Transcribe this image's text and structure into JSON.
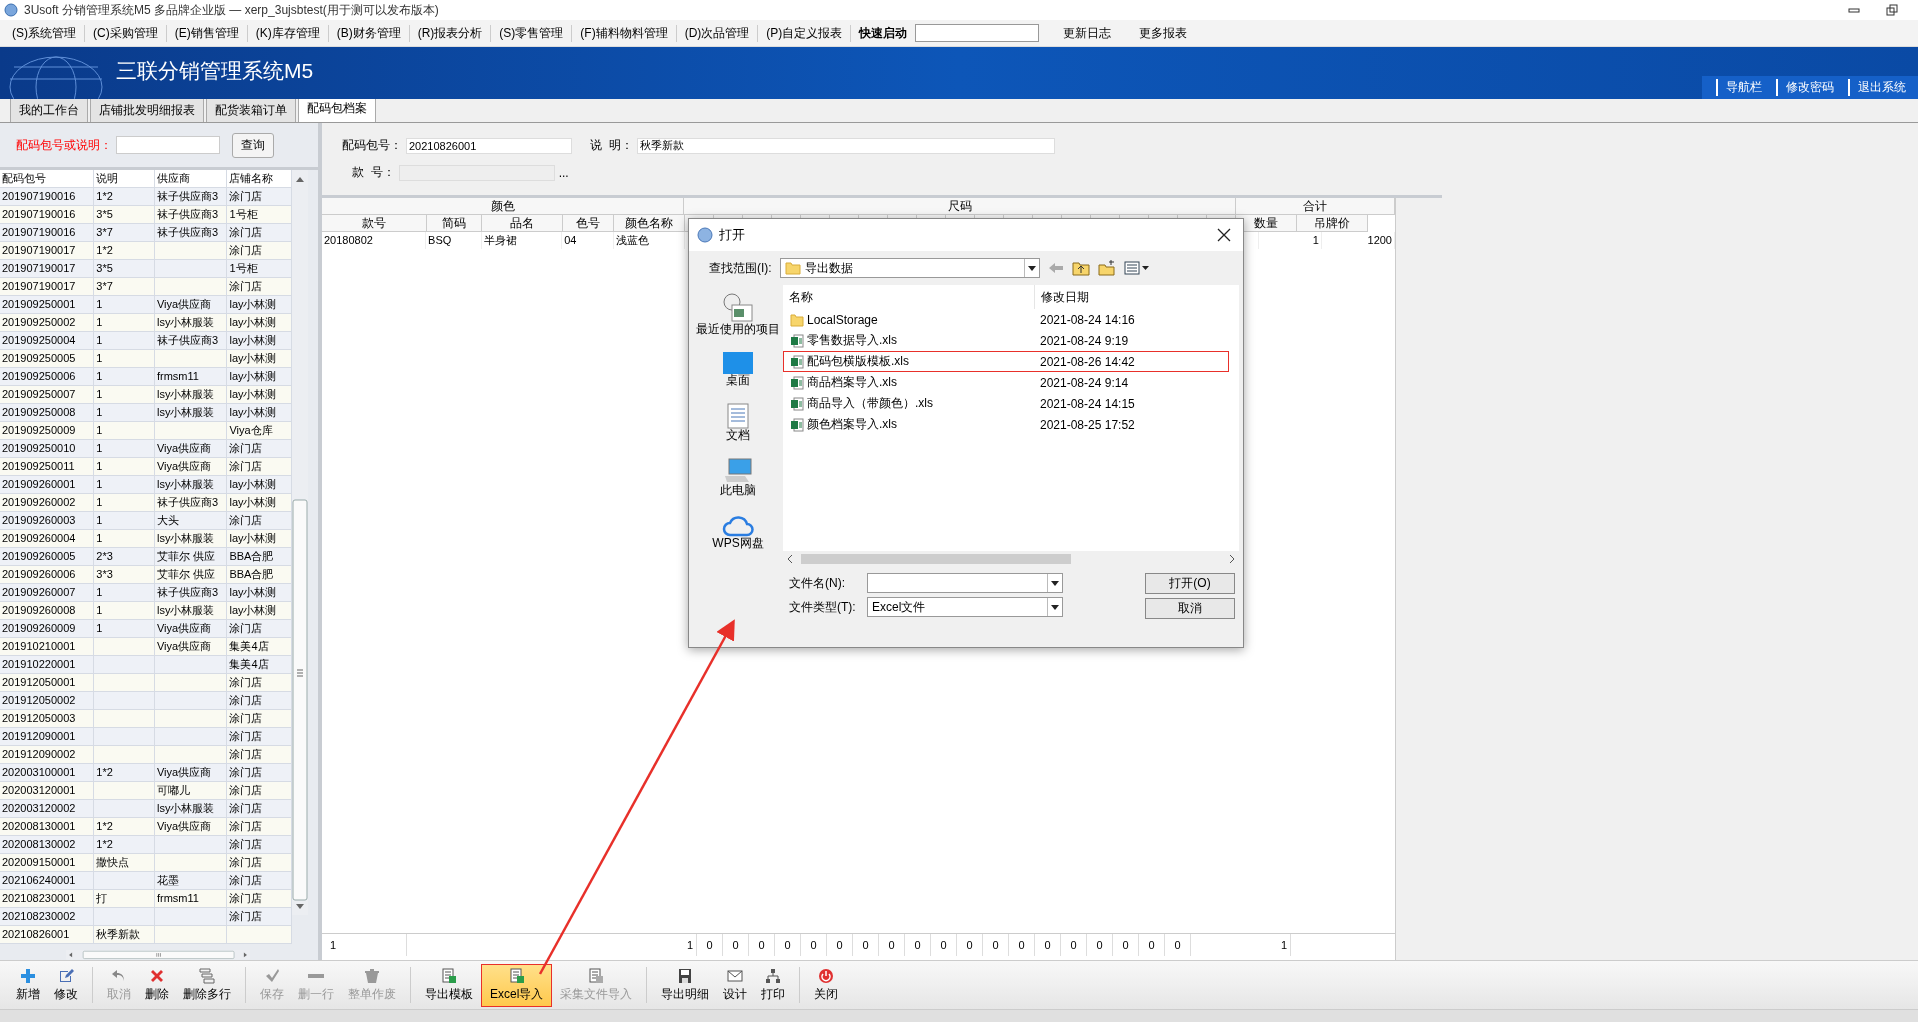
{
  "window": {
    "title": "3Usoft 分销管理系统M5 多品牌企业版 — xerp_3ujsbtest(用于测可以发布版本)"
  },
  "menu": [
    "(S)系统管理",
    "(C)采购管理",
    "(E)销售管理",
    "(K)库存管理",
    "(B)财务管理",
    "(R)报表分析",
    "(S)零售管理",
    "(F)辅料物料管理",
    "(D)次品管理",
    "(P)自定义报表"
  ],
  "quick_launch": {
    "label": "快速启动"
  },
  "menu_links": [
    "更新日志",
    "更多报表"
  ],
  "banner": {
    "title": "三联分销管理系统M5",
    "links": [
      "导航栏",
      "修改密码",
      "退出系统"
    ]
  },
  "tabs": [
    {
      "label": "我的工作台",
      "selected": false
    },
    {
      "label": "店铺批发明细报表",
      "selected": false
    },
    {
      "label": "配货装箱订单",
      "selected": false
    },
    {
      "label": "配码包档案",
      "selected": true
    }
  ],
  "search": {
    "label": "配码包号或说明：",
    "button": "查询"
  },
  "list": {
    "columns": [
      "配码包号",
      "说明",
      "供应商",
      "店铺名称"
    ],
    "rows": [
      {
        "no": "201907190016",
        "desc": "1*2",
        "supplier": "袜子供应商3",
        "store": "涂门店"
      },
      {
        "no": "201907190016",
        "desc": "3*5",
        "supplier": "袜子供应商3",
        "store": "1号柜"
      },
      {
        "no": "201907190016",
        "desc": "3*7",
        "supplier": "袜子供应商3",
        "store": "涂门店"
      },
      {
        "no": "201907190017",
        "desc": "1*2",
        "store": "涂门店"
      },
      {
        "no": "201907190017",
        "desc": "3*5",
        "store": "1号柜"
      },
      {
        "no": "201907190017",
        "desc": "3*7",
        "store": "涂门店"
      },
      {
        "no": "201909250001",
        "desc": "1",
        "supplier": "Viya供应商",
        "store": "lay小林测"
      },
      {
        "no": "201909250002",
        "desc": "1",
        "supplier": "lsy小林服装",
        "store": "lay小林测"
      },
      {
        "no": "201909250004",
        "desc": "1",
        "supplier": "袜子供应商3",
        "store": "lay小林测"
      },
      {
        "no": "201909250005",
        "desc": "1",
        "store": "lay小林测"
      },
      {
        "no": "201909250006",
        "desc": "1",
        "supplier": "frmsm11",
        "store": "lay小林测"
      },
      {
        "no": "201909250007",
        "desc": "1",
        "supplier": "lsy小林服装",
        "store": "lay小林测"
      },
      {
        "no": "201909250008",
        "desc": "1",
        "supplier": "lsy小林服装",
        "store": "lay小林测"
      },
      {
        "no": "201909250009",
        "desc": "1",
        "store": "Viya仓库"
      },
      {
        "no": "201909250010",
        "desc": "1",
        "supplier": "Viya供应商",
        "store": "涂门店"
      },
      {
        "no": "201909250011",
        "desc": "1",
        "supplier": "Viya供应商",
        "store": "涂门店"
      },
      {
        "no": "201909260001",
        "desc": "1",
        "supplier": "lsy小林服装",
        "store": "lay小林测"
      },
      {
        "no": "201909260002",
        "desc": "1",
        "supplier": "袜子供应商3",
        "store": "lay小林测"
      },
      {
        "no": "201909260003",
        "desc": "1",
        "supplier": "大头",
        "store": "涂门店"
      },
      {
        "no": "201909260004",
        "desc": "1",
        "supplier": "lsy小林服装",
        "store": "lay小林测"
      },
      {
        "no": "201909260005",
        "desc": "2*3",
        "supplier": "艾菲尔 供应",
        "store": "BBA合肥"
      },
      {
        "no": "201909260006",
        "desc": "3*3",
        "supplier": "艾菲尔 供应",
        "store": "BBA合肥"
      },
      {
        "no": "201909260007",
        "desc": "1",
        "supplier": "袜子供应商3",
        "store": "lay小林测"
      },
      {
        "no": "201909260008",
        "desc": "1",
        "supplier": "lsy小林服装",
        "store": "lay小林测"
      },
      {
        "no": "201909260009",
        "desc": "1",
        "supplier": "Viya供应商",
        "store": "涂门店"
      },
      {
        "no": "201910210001",
        "supplier": "Viya供应商",
        "store": "集美4店"
      },
      {
        "no": "201910220001",
        "store": "集美4店"
      },
      {
        "no": "201912050001",
        "store": "涂门店"
      },
      {
        "no": "201912050002",
        "store": "涂门店"
      },
      {
        "no": "201912050003",
        "store": "涂门店"
      },
      {
        "no": "201912090001",
        "store": "涂门店"
      },
      {
        "no": "201912090002",
        "store": "涂门店"
      },
      {
        "no": "202003100001",
        "desc": "1*2",
        "supplier": "Viya供应商",
        "store": "涂门店"
      },
      {
        "no": "202003120001",
        "supplier": "可嘟儿",
        "store": "涂门店"
      },
      {
        "no": "202003120002",
        "supplier": "lsy小林服装",
        "store": "涂门店"
      },
      {
        "no": "202008130001",
        "desc": "1*2",
        "supplier": "Viya供应商",
        "store": "涂门店"
      },
      {
        "no": "202008130002",
        "desc": "1*2",
        "store": "涂门店"
      },
      {
        "no": "202009150001",
        "desc": "撒快点",
        "store": "涂门店"
      },
      {
        "no": "202106240001",
        "supplier": "花墨",
        "store": "涂门店"
      },
      {
        "no": "202108230001",
        "desc": "打",
        "supplier": "frmsm11",
        "store": "涂门店"
      },
      {
        "no": "202108230002",
        "store": "涂门店"
      },
      {
        "no": "20210826001",
        "desc": "秋季新款"
      }
    ]
  },
  "form": {
    "fields": [
      {
        "kind": "text",
        "label": "配码包号：",
        "value": "20210826001"
      },
      {
        "kind": "text",
        "label": "说  明：",
        "value": "秋季新款"
      },
      {
        "kind": "lookup",
        "label": "款  号：",
        "button": "..."
      }
    ]
  },
  "detail": {
    "groups": [
      {
        "label": "颜色",
        "columns": [
          "款号",
          "简码",
          "品名",
          "色号",
          "颜色名称"
        ]
      },
      {
        "label": "尺码"
      },
      {
        "label": "合计",
        "columns": [
          "数量",
          "吊牌价"
        ]
      }
    ],
    "rows": [
      {
        "cells": [
          "20180802",
          "BSQ",
          "半身裙",
          "04",
          "浅蓝色"
        ],
        "qty": "1",
        "price": "1200"
      }
    ],
    "summary": {
      "first": "1",
      "second": "1",
      "sizes": [
        "0",
        "0",
        "0",
        "0",
        "0",
        "0",
        "0",
        "0",
        "0",
        "0",
        "0",
        "0",
        "0",
        "0",
        "0",
        "0",
        "0",
        "0",
        "0"
      ],
      "qty": "1"
    }
  },
  "toolbar": [
    {
      "label": "新增",
      "kind": "plus",
      "disabled": false,
      "highlighted": false
    },
    {
      "label": "修改",
      "kind": "edit",
      "disabled": false,
      "highlighted": false
    },
    {
      "label": "取消",
      "kind": "undo",
      "disabled": true,
      "highlighted": false
    },
    {
      "label": "删除",
      "kind": "cross",
      "disabled": false,
      "highlighted": false
    },
    {
      "label": "删除多行",
      "kind": "stack",
      "disabled": false,
      "highlighted": false
    },
    {
      "label": "保存",
      "kind": "check",
      "disabled": true,
      "highlighted": false
    },
    {
      "label": "删一行",
      "kind": "minus",
      "disabled": true,
      "highlighted": false
    },
    {
      "label": "整单作废",
      "kind": "trash",
      "disabled": true,
      "highlighted": false
    },
    {
      "label": "导出模板",
      "kind": "sheet",
      "disabled": false,
      "highlighted": false
    },
    {
      "label": "Excel导入",
      "kind": "sheet",
      "disabled": false,
      "highlighted": true
    },
    {
      "label": "采集文件导入",
      "kind": "sheet",
      "disabled": true,
      "highlighted": false
    },
    {
      "label": "导出明细",
      "kind": "disk",
      "disabled": false,
      "highlighted": false
    },
    {
      "label": "设计",
      "kind": "mail",
      "disabled": false,
      "highlighted": false
    },
    {
      "label": "打印",
      "kind": "tree",
      "disabled": false,
      "highlighted": false
    },
    {
      "label": "关闭",
      "kind": "power",
      "disabled": false,
      "highlighted": false
    }
  ],
  "dialog": {
    "title": "打开",
    "look_in": {
      "label": "查找范围(I):",
      "value": "导出数据"
    },
    "places": [
      {
        "kind": "recent",
        "label": "最近使用的项目"
      },
      {
        "kind": "desktop",
        "label": "桌面"
      },
      {
        "kind": "documents",
        "label": "文档"
      },
      {
        "kind": "computer",
        "label": "此电脑"
      },
      {
        "kind": "cloud",
        "label": "WPS网盘"
      }
    ],
    "columns": [
      "名称",
      "修改日期"
    ],
    "files": [
      {
        "kind": "folder",
        "name": "LocalStorage",
        "date": "2021-08-24 14:16",
        "highlighted": false
      },
      {
        "kind": "xls",
        "name": "零售数据导入.xls",
        "date": "2021-08-24 9:19",
        "highlighted": false
      },
      {
        "kind": "xls",
        "name": "配码包横版模板.xls",
        "date": "2021-08-26 14:42",
        "highlighted": true
      },
      {
        "kind": "xls",
        "name": "商品档案导入.xls",
        "date": "2021-08-24 9:14",
        "highlighted": false
      },
      {
        "kind": "xls",
        "name": "商品导入（带颜色）.xls",
        "date": "2021-08-24 14:15",
        "highlighted": false
      },
      {
        "kind": "xls",
        "name": "颜色档案导入.xls",
        "date": "2021-08-25 17:52",
        "highlighted": false
      }
    ],
    "file_name": {
      "label": "文件名(N):"
    },
    "file_type": {
      "label": "文件类型(T):",
      "value": "Excel文件"
    },
    "buttons": [
      "打开(O)",
      "取消"
    ]
  }
}
